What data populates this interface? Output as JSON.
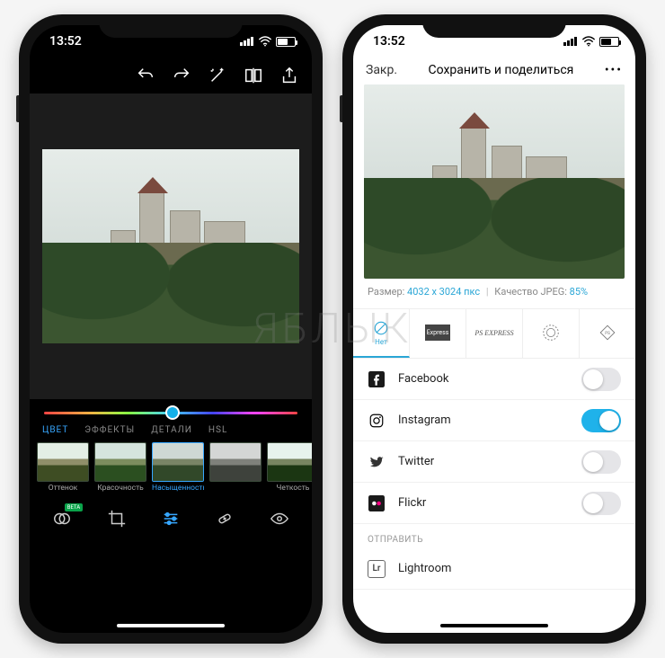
{
  "status": {
    "time": "13:52"
  },
  "editor": {
    "tabs": [
      "ЦВЕТ",
      "ЭФФЕКТЫ",
      "ДЕТАЛИ",
      "HSL"
    ],
    "active_tab_index": 0,
    "presets": [
      {
        "label": "Оттенок"
      },
      {
        "label": "Красочность"
      },
      {
        "label": "Насыщенность"
      },
      {
        "label": ""
      },
      {
        "label": "Четкость"
      }
    ],
    "active_preset_index": 2,
    "beta_badge": "BETA"
  },
  "share": {
    "close_label": "Закр.",
    "title": "Сохранить и поделиться",
    "size_label": "Размер:",
    "size_value": "4032 x 3024 пкс",
    "quality_label": "Качество JPEG:",
    "quality_value": "85%",
    "watermark_none_label": "Нет",
    "social": [
      {
        "name": "Facebook",
        "icon": "facebook",
        "on": false
      },
      {
        "name": "Instagram",
        "icon": "instagram",
        "on": true
      },
      {
        "name": "Twitter",
        "icon": "twitter",
        "on": false
      },
      {
        "name": "Flickr",
        "icon": "flickr",
        "on": false
      }
    ],
    "send_section_label": "ОТПРАВИТЬ",
    "send_targets": [
      {
        "name": "Lightroom",
        "icon": "lightroom"
      }
    ]
  },
  "watermark_overlay": "ЯБЛЫК"
}
